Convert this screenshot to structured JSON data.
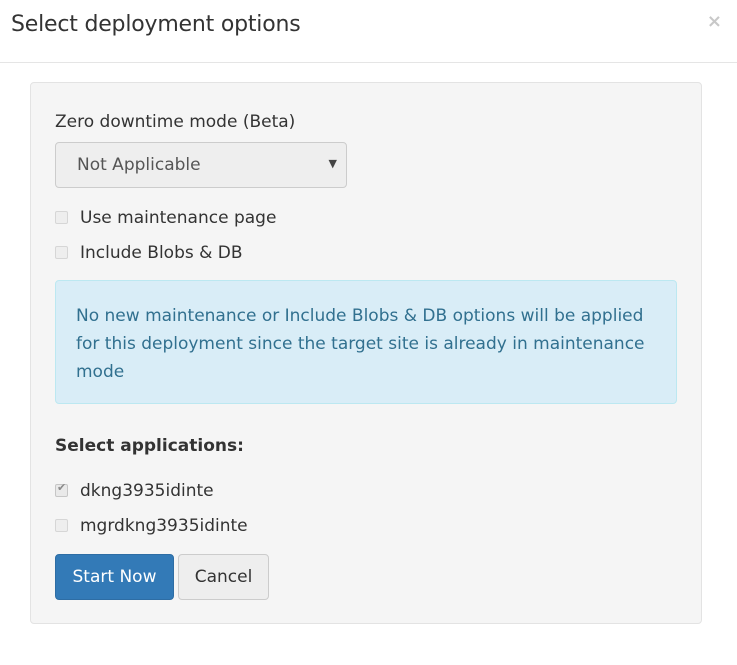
{
  "modal": {
    "title": "Select deployment options",
    "close_label": "×"
  },
  "downtime": {
    "label": "Zero downtime mode (Beta)",
    "selected": "Not Applicable",
    "caret": "▼"
  },
  "options": [
    {
      "label": "Use maintenance page",
      "checked": false,
      "disabled": true
    },
    {
      "label": "Include Blobs & DB",
      "checked": false,
      "disabled": true
    }
  ],
  "alert": {
    "text": "No new maintenance or Include Blobs & DB options will be applied for this deployment since the target site is already in maintenance mode"
  },
  "applications": {
    "heading": "Select applications:",
    "items": [
      {
        "label": "dkng3935idinte",
        "checked": true,
        "disabled": true
      },
      {
        "label": "mgrdkng3935idinte",
        "checked": false,
        "disabled": true
      }
    ]
  },
  "buttons": {
    "start": "Start Now",
    "cancel": "Cancel"
  },
  "colors": {
    "primary": "#337ab7",
    "alert_bg": "#d9edf7",
    "alert_text": "#31708f",
    "panel_bg": "#f5f5f5"
  }
}
